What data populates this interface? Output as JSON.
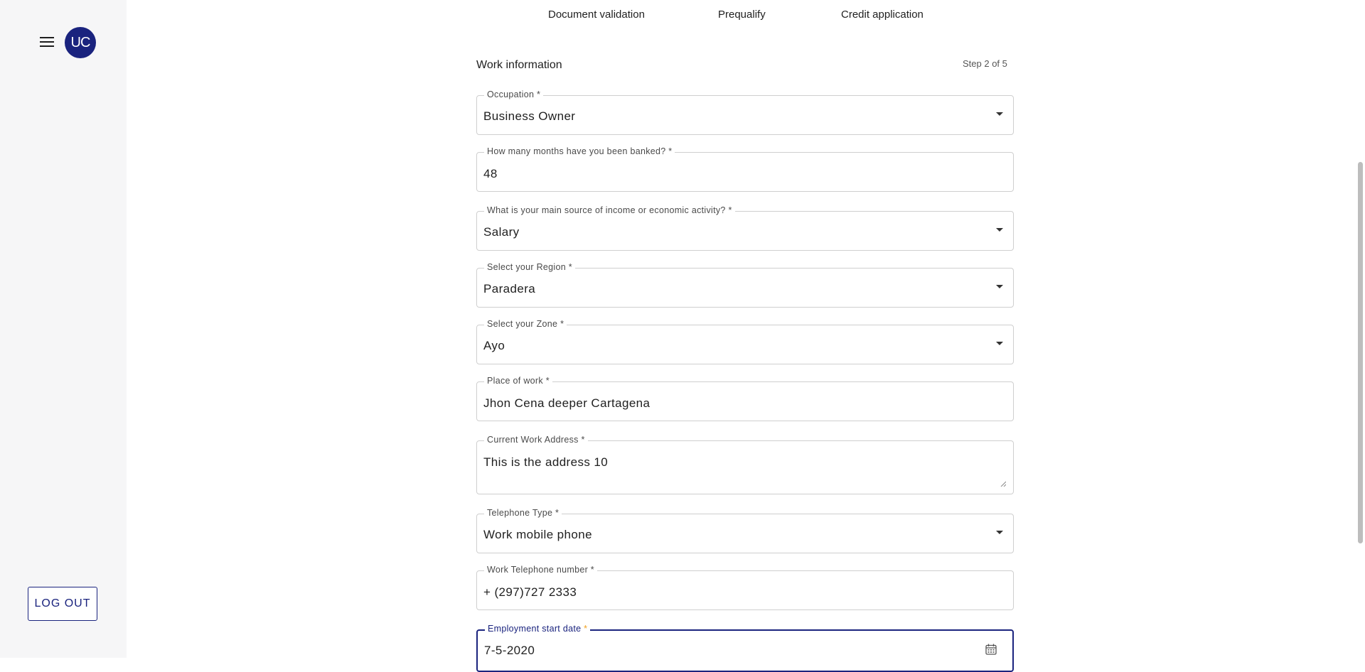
{
  "sidebar": {
    "menu_icon": "hamburger-menu-icon",
    "avatar_initials": "UC",
    "logout_label": "LOG OUT"
  },
  "steps": [
    {
      "label": "Document validation"
    },
    {
      "label": "Prequalify"
    },
    {
      "label": "Credit application"
    }
  ],
  "form": {
    "section_title": "Work information",
    "step_indicator": "Step 2 of 5",
    "fields": {
      "occupation": {
        "label": "Occupation *",
        "value": "Business Owner"
      },
      "months_banked": {
        "label": "How many months have you been banked? *",
        "value": "48"
      },
      "income_source": {
        "label": "What is your main source of income or economic activity? *",
        "value": "Salary"
      },
      "region": {
        "label": "Select your Region *",
        "value": "Paradera"
      },
      "zone": {
        "label": "Select your Zone *",
        "value": "Ayo"
      },
      "place_of_work": {
        "label": "Place of work *",
        "value": "Jhon Cena deeper Cartagena"
      },
      "work_address": {
        "label": "Current Work Address *",
        "value": "This is the address 10"
      },
      "telephone_type": {
        "label": "Telephone Type *",
        "value": "Work mobile phone"
      },
      "work_phone": {
        "label": "Work Telephone number *",
        "value": "+ (297)727 2333"
      },
      "employment_start": {
        "label": "Employment start date",
        "required_mark": "*",
        "value": "7-5-2020"
      }
    }
  },
  "colors": {
    "accent": "#1a237e",
    "required_star_focused": "#f0a020",
    "border": "#cfcfcf",
    "sidebar_bg": "#f6f6f7"
  }
}
